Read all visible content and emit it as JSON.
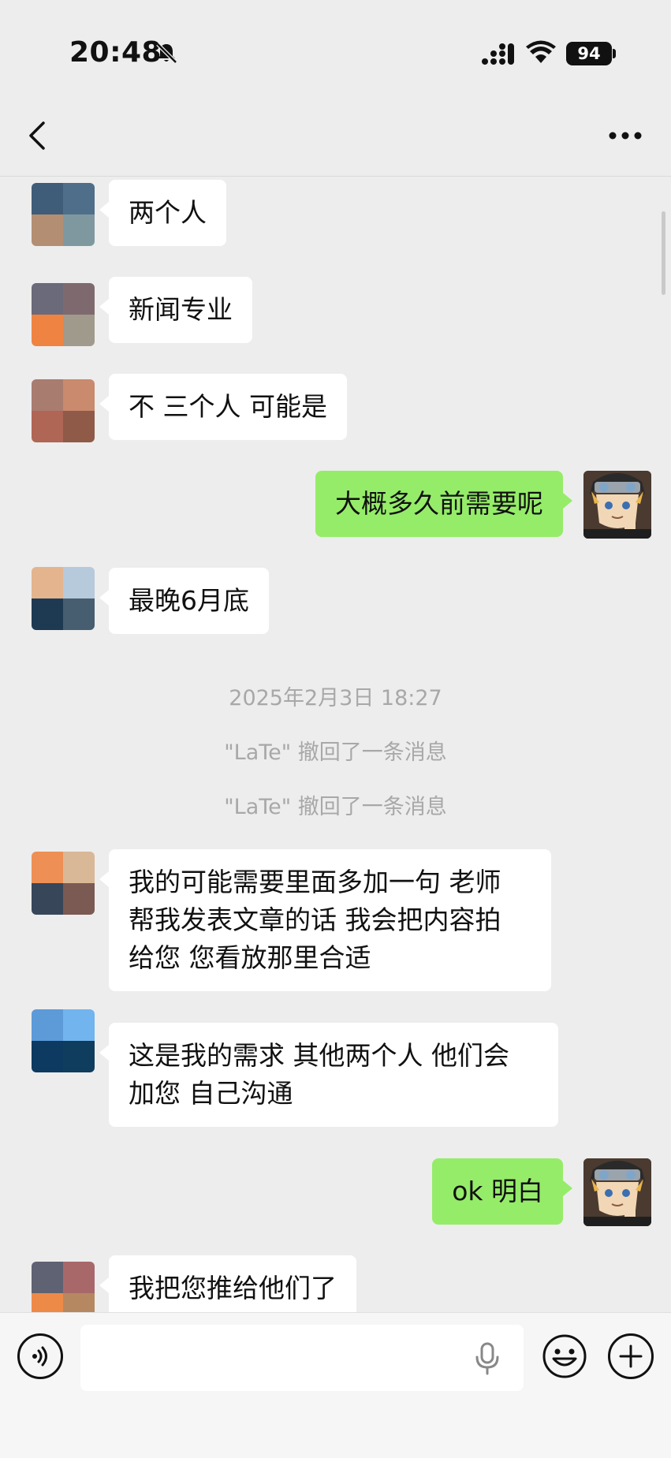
{
  "status_bar": {
    "time": "20:48",
    "battery": "94",
    "icons": [
      "bell-off-icon",
      "cellular-signal-icon",
      "wifi-icon",
      "battery-icon"
    ]
  },
  "header": {
    "icons": [
      "chevron-left-icon",
      "more-horizontal-icon"
    ]
  },
  "messages": [
    {
      "direction": "in",
      "text": "两个人"
    },
    {
      "direction": "in",
      "text": "新闻专业"
    },
    {
      "direction": "in",
      "text": "不 三个人 可能是"
    },
    {
      "direction": "out",
      "text": "大概多久前需要呢"
    },
    {
      "direction": "in",
      "text": "最晚6月底"
    },
    {
      "direction": "in",
      "text": "我的可能需要里面多加一句 老师\n帮我发表文章的话 我会把内容拍\n给您 您看放那里合适"
    },
    {
      "direction": "in",
      "text": "这是我的需求 其他两个人 他们会\n加您 自己沟通"
    },
    {
      "direction": "out",
      "text": "ok 明白"
    },
    {
      "direction": "in",
      "text": "我把您推给他们了"
    }
  ],
  "system": {
    "timestamp": "2025年2月3日 18:27",
    "recall_1": "\"LaTe\" 撤回了一条消息",
    "recall_2": "\"LaTe\" 撤回了一条消息"
  },
  "input_bar": {
    "placeholder": "",
    "icons": [
      "voice-icon",
      "microphone-icon",
      "emoji-icon",
      "plus-icon"
    ]
  },
  "colors": {
    "background": "#ededed",
    "incoming_bubble": "#ffffff",
    "outgoing_bubble": "#95ec69",
    "system_text": "#a8a8a8"
  }
}
